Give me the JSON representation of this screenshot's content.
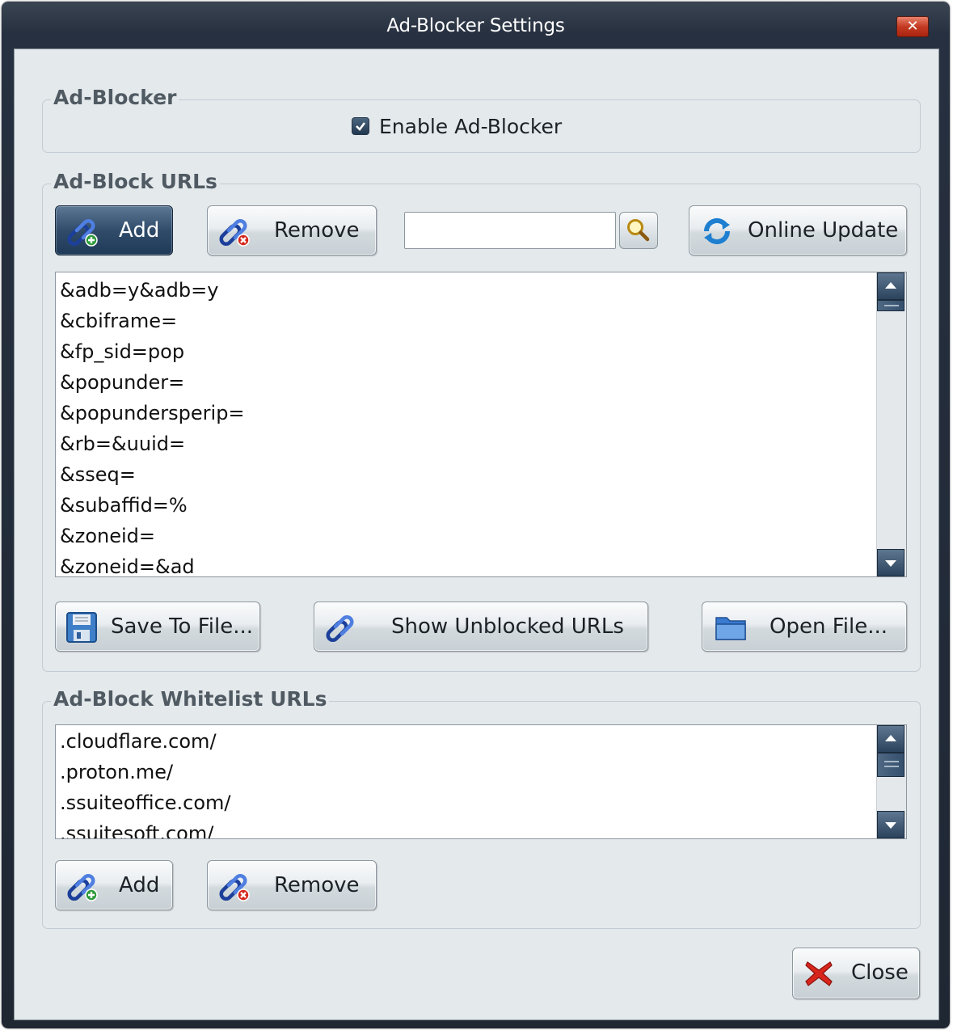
{
  "window": {
    "title": "Ad-Blocker Settings",
    "close_glyph": "✕"
  },
  "adblocker": {
    "legend": "Ad-Blocker",
    "enable_label": "Enable Ad-Blocker",
    "enabled": true
  },
  "urls": {
    "legend": "Ad-Block URLs",
    "add_label": "Add",
    "remove_label": "Remove",
    "search_value": "",
    "online_update_label": "Online Update",
    "items": [
      "&adb=y&adb=y",
      "&cbiframe=",
      "&fp_sid=pop",
      "&popunder=",
      "&popundersperip=",
      "&rb=&uuid=",
      "&sseq=",
      "&subaffid=%",
      "&zoneid=",
      "&zoneid=&ad"
    ],
    "save_label": "Save To File...",
    "show_unblocked_label": "Show Unblocked URLs",
    "open_label": "Open File..."
  },
  "whitelist": {
    "legend": "Ad-Block Whitelist URLs",
    "items": [
      ".cloudflare.com/",
      ".proton.me/",
      ".ssuiteoffice.com/",
      ".ssuitesoft.com/"
    ],
    "add_label": "Add",
    "remove_label": "Remove"
  },
  "footer": {
    "close_label": "Close"
  },
  "icons": {
    "add": "link-add-icon",
    "remove": "link-remove-icon",
    "search": "search-icon",
    "update": "refresh-icon",
    "save": "floppy-disk-icon",
    "unblocked": "link-icon",
    "open": "folder-icon",
    "close": "close-x-icon"
  },
  "colors": {
    "titlebar": "#273040",
    "client_bg": "#e4e9ec",
    "legend_text": "#505a62",
    "selected_button": "#304c6a"
  }
}
